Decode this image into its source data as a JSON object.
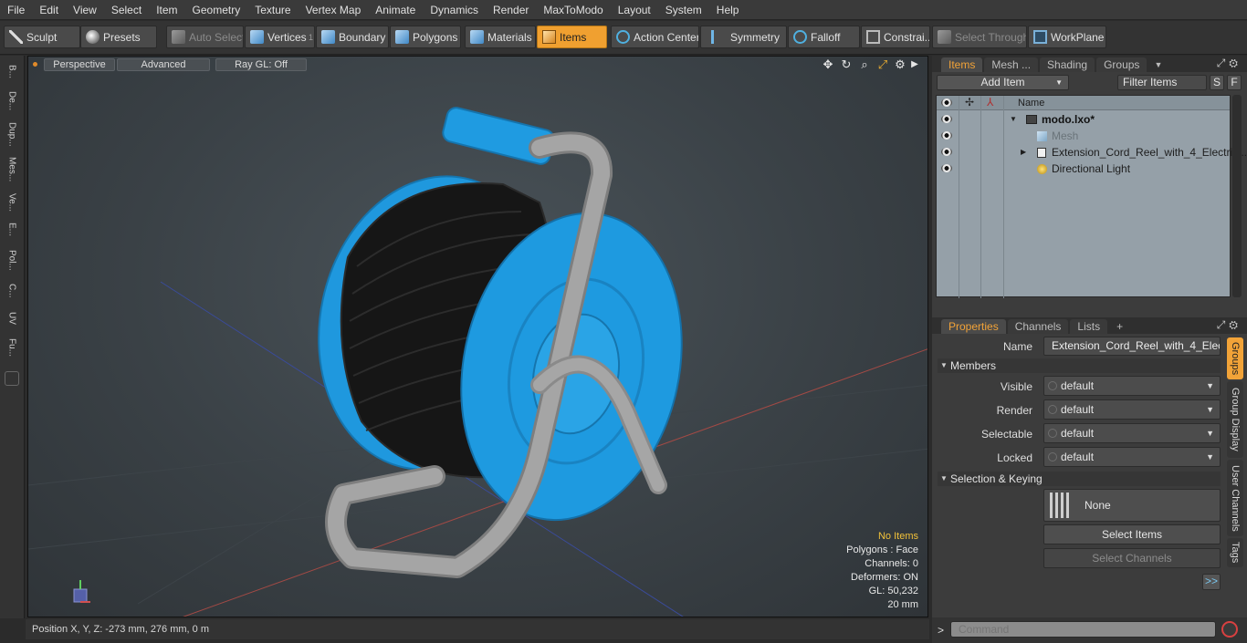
{
  "menubar": [
    "File",
    "Edit",
    "View",
    "Select",
    "Item",
    "Geometry",
    "Texture",
    "Vertex Map",
    "Animate",
    "Dynamics",
    "Render",
    "MaxToModo",
    "Layout",
    "System",
    "Help"
  ],
  "toolbar": {
    "sculpt": "Sculpt",
    "presets": "Presets",
    "auto_select": "Auto Select",
    "vertices": "Vertices",
    "vertices_count": "1",
    "boundary": "Boundary",
    "polygons": "Polygons",
    "materials": "Materials",
    "items": "Items",
    "action_center": "Action Center",
    "symmetry": "Symmetry",
    "falloff": "Falloff",
    "constraints": "Constrai...",
    "select_through": "Select Through",
    "workplane": "WorkPlane"
  },
  "left_tabs": [
    "B...",
    "De...",
    "Dup...",
    "Mes...",
    "Ve...",
    "E...",
    "Pol...",
    "C...",
    "UV",
    "Fu..."
  ],
  "viewport": {
    "view_mode": "Perspective",
    "shading": "Advanced",
    "raygl": "Ray GL: Off",
    "stats": {
      "selection": "No Items",
      "polygons": "Polygons : Face",
      "channels": "Channels: 0",
      "deformers": "Deformers: ON",
      "gl": "GL: 50,232",
      "unit": "20 mm"
    }
  },
  "statusbar": {
    "position": "Position X, Y, Z:   -273 mm, 276 mm, 0 m"
  },
  "items_panel": {
    "tabs": [
      "Items",
      "Mesh ...",
      "Shading",
      "Groups"
    ],
    "add_item": "Add Item",
    "filter_items": "Filter Items",
    "s_btn": "S",
    "f_btn": "F",
    "col_name": "Name",
    "rows": [
      {
        "label": "modo.lxo*",
        "type": "scene"
      },
      {
        "label": "Mesh",
        "type": "mesh"
      },
      {
        "label": "Extension_Cord_Reel_with_4_Electric...",
        "type": "group"
      },
      {
        "label": "Directional Light",
        "type": "light"
      }
    ]
  },
  "properties_panel": {
    "tabs": [
      "Properties",
      "Channels",
      "Lists",
      "+"
    ],
    "name_label": "Name",
    "name_value": "Extension_Cord_Reel_with_4_Electric",
    "members_section": "Members",
    "visible_label": "Visible",
    "visible_value": "default",
    "render_label": "Render",
    "render_value": "default",
    "selectable_label": "Selectable",
    "selectable_value": "default",
    "locked_label": "Locked",
    "locked_value": "default",
    "selection_section": "Selection & Keying",
    "none_label": "None",
    "select_items": "Select Items",
    "select_channels": "Select Channels",
    "more_btn": ">>",
    "side_tabs": [
      "Groups",
      "Group Display",
      "User Channels",
      "Tags"
    ]
  },
  "command": {
    "prompt": ">",
    "placeholder": "Command"
  },
  "colors": {
    "accent": "#f2a338",
    "reel_blue": "#1e9ae0",
    "cable": "#1c1c1c",
    "frame": "#9a9a9a"
  }
}
